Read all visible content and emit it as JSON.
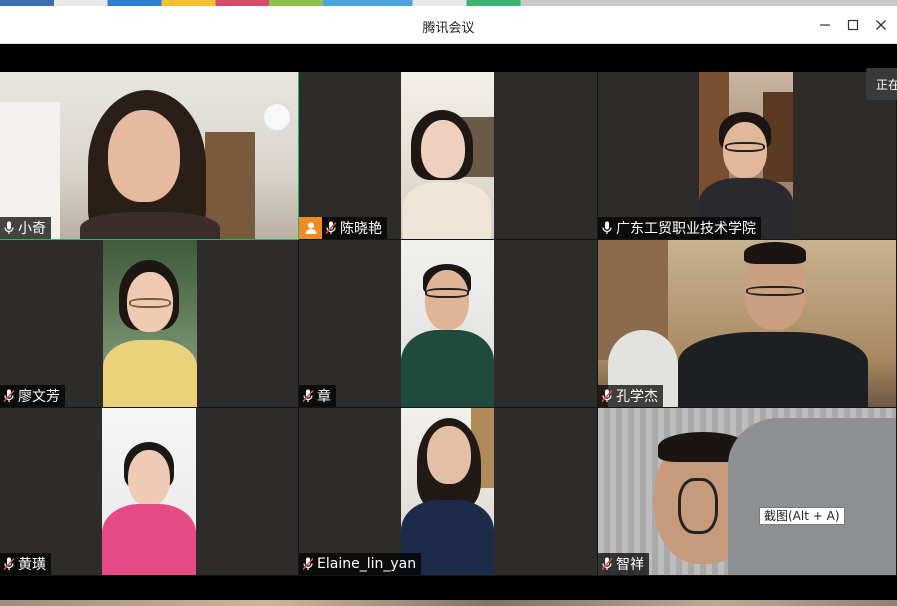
{
  "window": {
    "title": "腾讯会议"
  },
  "side_tab": {
    "label": "正在"
  },
  "tooltip": {
    "text": "截图(Alt + A)"
  },
  "participants": [
    {
      "name": "小奇",
      "mic": "on",
      "speaking": true
    },
    {
      "name": "陈晓艳",
      "mic": "muted",
      "avatar_badge": true
    },
    {
      "name": "广东工贸职业技术学院",
      "mic": "on"
    },
    {
      "name": "廖文芳",
      "mic": "muted"
    },
    {
      "name": "章",
      "mic": "muted"
    },
    {
      "name": "孔学杰",
      "mic": "muted"
    },
    {
      "name": "黄璜",
      "mic": "muted"
    },
    {
      "name": "Elaine_lin_yan",
      "mic": "muted"
    },
    {
      "name": "智祥",
      "mic": "muted"
    }
  ],
  "colors": {
    "speaking_border": "#2fb35d",
    "avatar_badge": "#f08a24",
    "muted_mic": "#e04b4b"
  }
}
